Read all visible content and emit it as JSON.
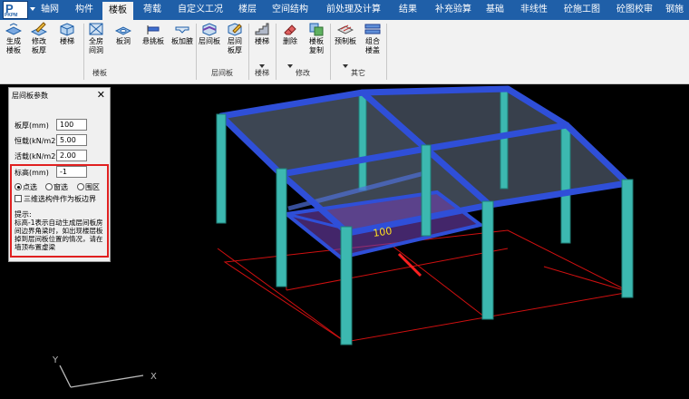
{
  "menubar": {
    "logo_letter": "P",
    "logo_caption": "PKPM",
    "tabs": [
      "轴网",
      "构件",
      "楼板",
      "荷载",
      "自定义工况",
      "楼层",
      "空间结构",
      "前处理及计算",
      "结果",
      "补充验算",
      "基础",
      "非线性",
      "砼施工图",
      "砼图校审",
      "钢施"
    ],
    "active_tab": "楼板"
  },
  "ribbon": {
    "buttons": {
      "gen_slab": "生成\n楼板",
      "edit_thickness": "修改\n板厚",
      "floor_stair": "楼梯",
      "full_room_hole": "全房\n间洞",
      "slab_hole": "板洞",
      "cantilever_slab": "悬挑板",
      "slab_add_thick": "板加腋",
      "mezz_slab": "层间板",
      "mezz_thickness": "层间\n板厚",
      "stairs": "楼梯",
      "delete": "删除",
      "slab_copy": "楼板\n复制",
      "precast_slab": "预制板",
      "combined_roof": "组合\n楼盖"
    },
    "groups": {
      "slab": "楼板",
      "mezz": "层间板",
      "stairs": "楼梯",
      "edit": "修改",
      "other": "其它"
    }
  },
  "panel": {
    "title": "层间板参数",
    "thickness_label": "板厚(mm)",
    "thickness_value": "100",
    "dead_label": "恒载(kN/m2)",
    "dead_value": "5.00",
    "live_label": "活载(kN/m2)",
    "live_value": "2.00",
    "elevation_label": "标高(mm)",
    "elevation_value": "-1",
    "radio_point": "点选",
    "radio_window": "窗选",
    "radio_region": "围区",
    "selected_mode": "点选",
    "checkbox_label": "三维选构件作为板边界",
    "checkbox_checked": false,
    "hint_title": "提示:",
    "hint_text": "标高-1表示自动生成层间板房间边界角梁时，如出现楼层板掉到层间板位置的情况，请在墙顶布置虚梁"
  },
  "scene": {
    "slab_label": "100",
    "axis_x": "X",
    "axis_y": "Y"
  },
  "colors": {
    "menubar": "#1f5fa8",
    "beam": "#2f4fd8",
    "column": "#3cb8b0",
    "slab_fill": "#6f7f98",
    "mezz_slab": "#7040b0",
    "grid_red": "#d01010",
    "panel_outline": "#e02020"
  }
}
